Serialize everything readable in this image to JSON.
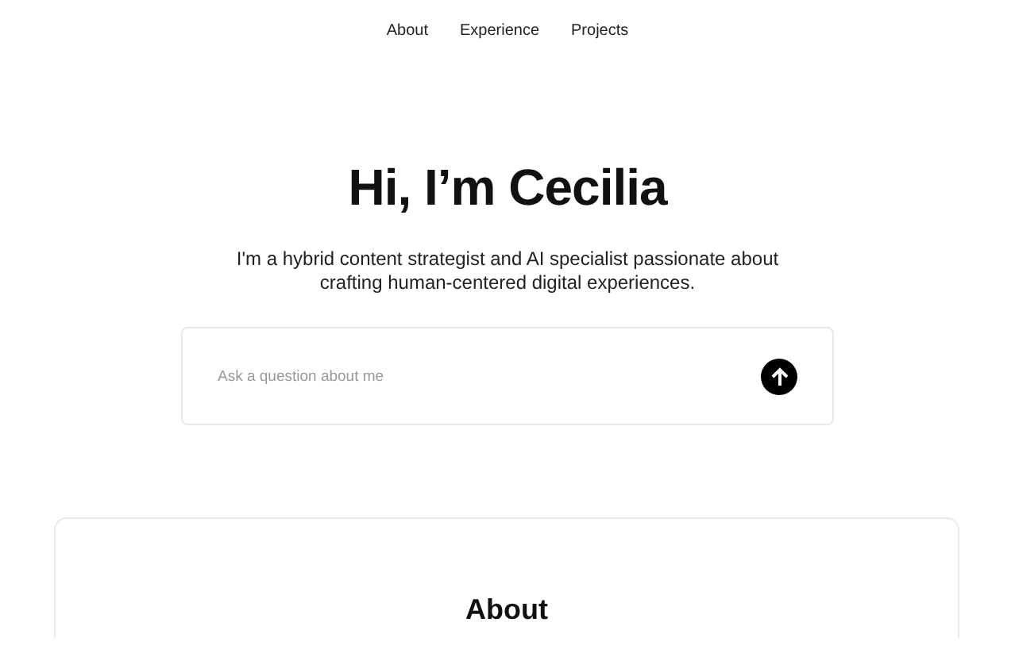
{
  "nav": [
    "About",
    "Experience",
    "Projects"
  ],
  "hero": {
    "title": "Hi, I’m Cecilia",
    "subtitle": "I'm a hybrid content strategist and AI specialist passionate about crafting human-centered digital experiences."
  },
  "ask": {
    "placeholder": "Ask a question about me"
  },
  "about_section": {
    "heading": "About"
  }
}
